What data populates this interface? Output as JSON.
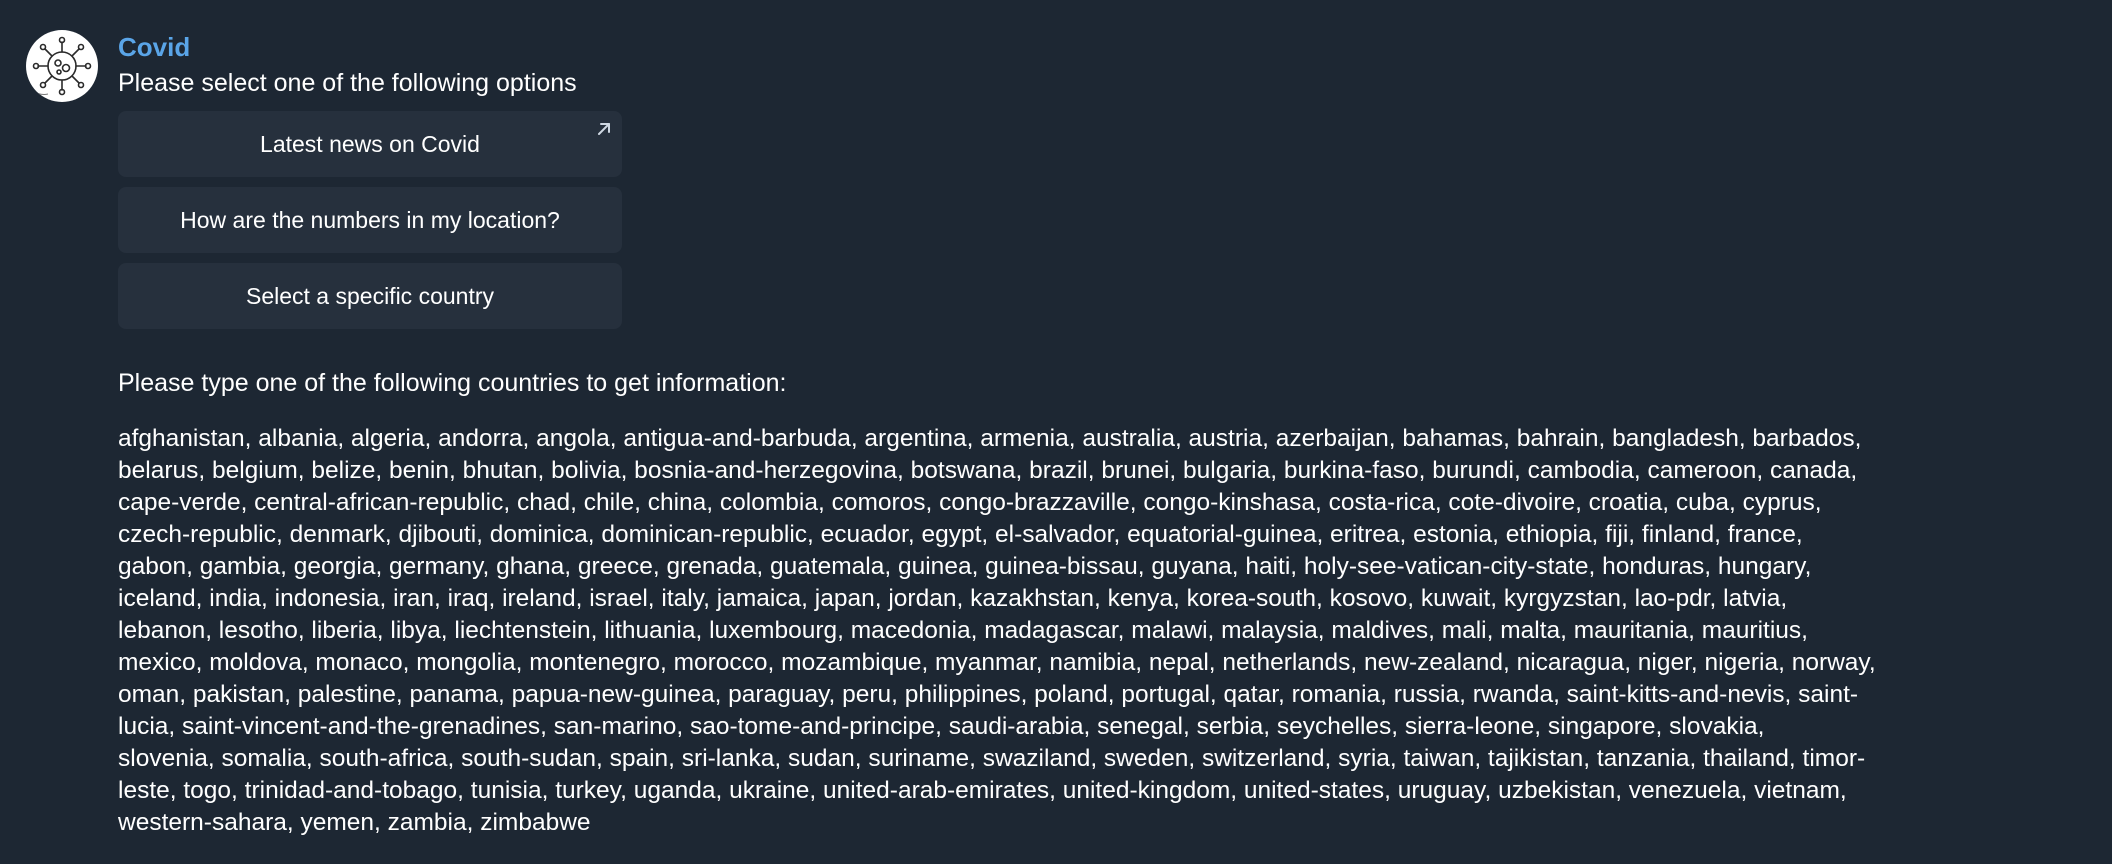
{
  "chat": {
    "sender": "Covid",
    "avatar_icon": "virus-icon",
    "prompt": "Please select one of the following options",
    "buttons": [
      {
        "label": "Latest news on Covid",
        "icon": "external-link-arrow-icon"
      },
      {
        "label": "How are the numbers in my location?"
      },
      {
        "label": "Select a specific country"
      }
    ],
    "type_header": "Please type one of the following countries to get information:",
    "countries_text": "afghanistan, albania, algeria, andorra, angola, antigua-and-barbuda, argentina, armenia, australia, austria, azerbaijan, bahamas, bahrain, bangladesh, barbados,\nbelarus, belgium, belize, benin, bhutan, bolivia, bosnia-and-herzegovina, botswana, brazil, brunei, bulgaria, burkina-faso, burundi, cambodia, cameroon, canada,\ncape-verde, central-african-republic, chad, chile, china, colombia, comoros, congo-brazzaville, congo-kinshasa, costa-rica, cote-divoire, croatia, cuba, cyprus,\nczech-republic, denmark, djibouti, dominica, dominican-republic, ecuador, egypt, el-salvador, equatorial-guinea, eritrea, estonia, ethiopia, fiji, finland, france,\ngabon, gambia, georgia, germany, ghana, greece, grenada, guatemala, guinea, guinea-bissau, guyana, haiti, holy-see-vatican-city-state, honduras, hungary,\niceland, india, indonesia, iran, iraq, ireland, israel, italy, jamaica, japan, jordan, kazakhstan, kenya, korea-south, kosovo, kuwait, kyrgyzstan, lao-pdr, latvia,\nlebanon, lesotho, liberia, libya, liechtenstein, lithuania, luxembourg, macedonia, madagascar, malawi, malaysia, maldives, mali, malta, mauritania, mauritius,\nmexico, moldova, monaco, mongolia, montenegro, morocco, mozambique, myanmar, namibia, nepal, netherlands, new-zealand, nicaragua, niger, nigeria, norway,\noman, pakistan, palestine, panama, papua-new-guinea, paraguay, peru, philippines, poland, portugal, qatar, romania, russia, rwanda, saint-kitts-and-nevis, saint-\nlucia, saint-vincent-and-the-grenadines, san-marino, sao-tome-and-principe, saudi-arabia, senegal, serbia, seychelles, sierra-leone, singapore, slovakia,\nslovenia, somalia, south-africa, south-sudan, spain, sri-lanka, sudan, suriname, swaziland, sweden, switzerland, syria, taiwan, tajikistan, tanzania, thailand, timor-\nleste, togo, trinidad-and-tobago, tunisia, turkey, uganda, ukraine, united-arab-emirates, united-kingdom, united-states, uruguay, uzbekistan, venezuela, vietnam,\nwestern-sahara, yemen, zambia, zimbabwe"
  },
  "colors": {
    "background": "#1d2733",
    "button_bg": "#26303d",
    "sender_name": "#5aa5e8",
    "text": "#ffffff"
  }
}
